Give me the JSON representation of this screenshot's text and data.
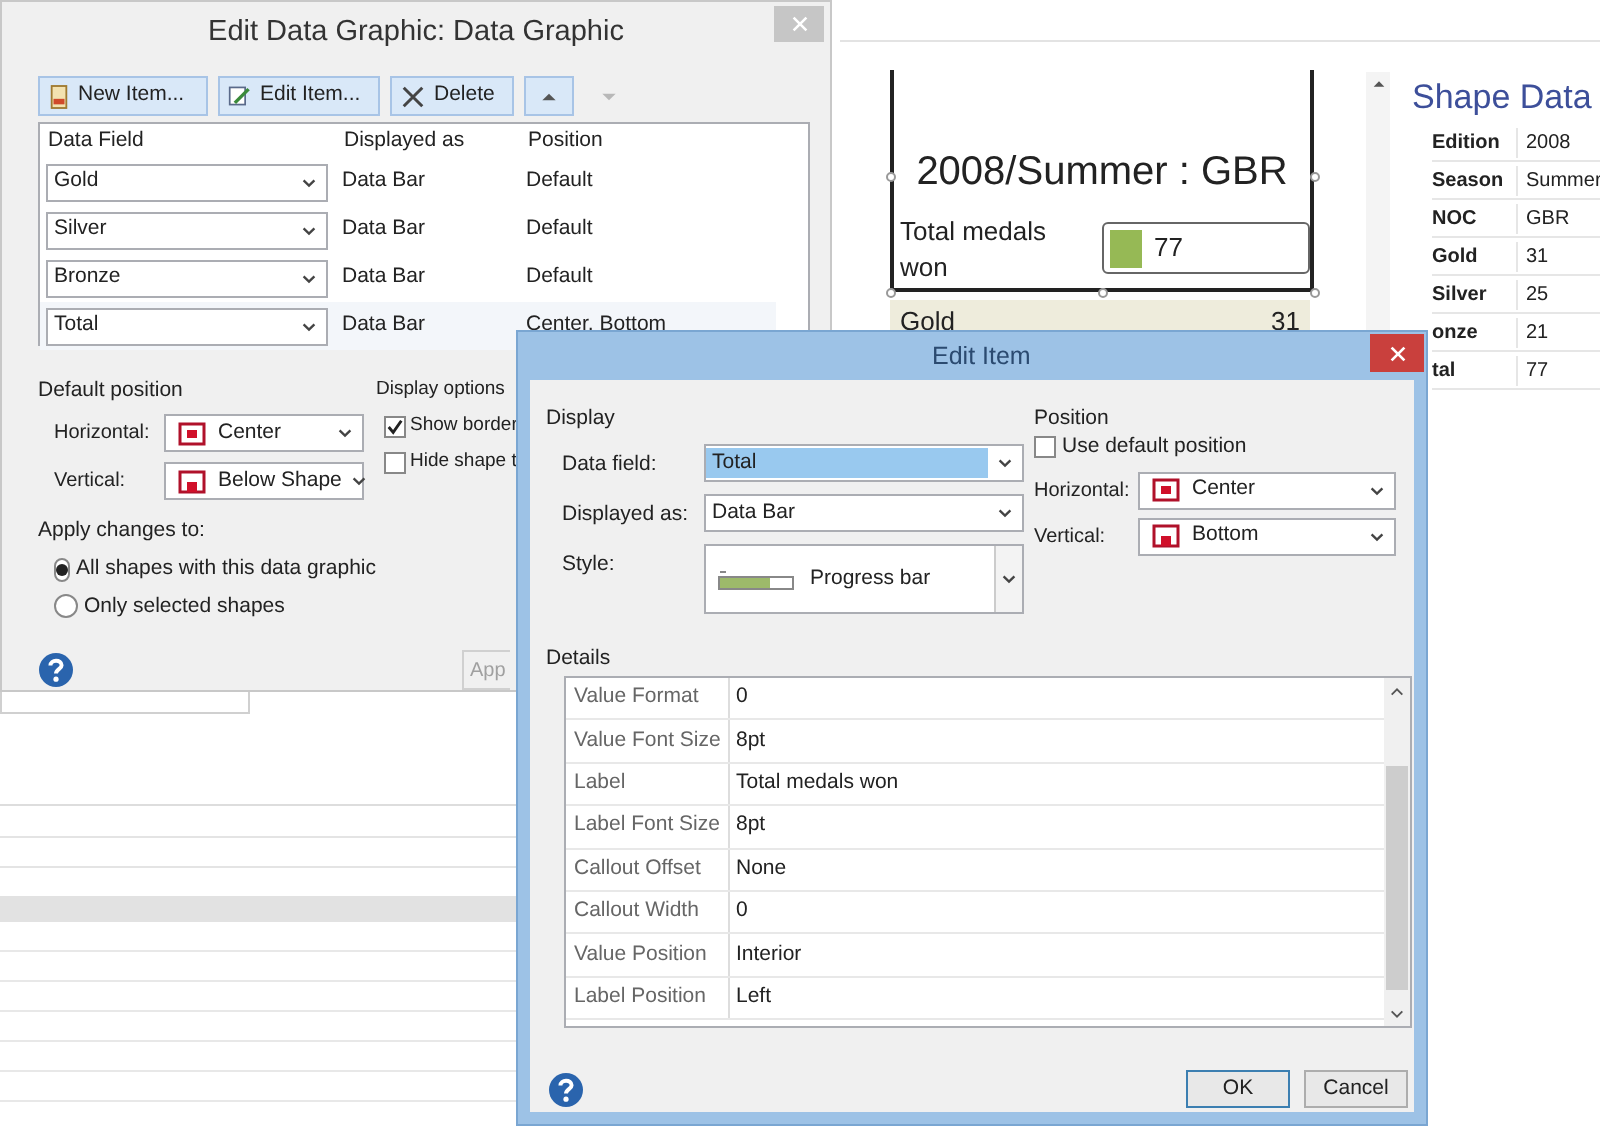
{
  "edit_data_graphic": {
    "title": "Edit Data Graphic: Data Graphic",
    "toolbar": [
      {
        "kind": "new",
        "label": "New Item..."
      },
      {
        "kind": "edit",
        "label": "Edit Item..."
      },
      {
        "kind": "delete",
        "label": "Delete"
      },
      {
        "kind": "move-up",
        "disabled": false
      },
      {
        "kind": "move-down",
        "disabled": true
      }
    ],
    "columns": [
      "Data Field",
      "Displayed as",
      "Position"
    ],
    "rows": [
      {
        "data_field": "Gold",
        "displayed_as": "Data Bar",
        "position": "Default",
        "selected": false
      },
      {
        "data_field": "Silver",
        "displayed_as": "Data Bar",
        "position": "Default",
        "selected": false
      },
      {
        "data_field": "Bronze",
        "displayed_as": "Data Bar",
        "position": "Default",
        "selected": false
      },
      {
        "data_field": "Total",
        "displayed_as": "Data Bar",
        "position": "Center, Bottom",
        "selected": true
      }
    ],
    "default_position": {
      "heading": "Default position",
      "fields": [
        {
          "label": "Horizontal:",
          "value": "Center"
        },
        {
          "label": "Vertical:",
          "value": "Below Shape"
        }
      ]
    },
    "display_options": {
      "heading": "Display options",
      "options": [
        {
          "label": "Show border",
          "checked": true
        },
        {
          "label": "Hide shape t",
          "checked": false
        }
      ]
    },
    "apply_changes": {
      "heading": "Apply changes to:",
      "options": [
        {
          "label": "All shapes with this data graphic",
          "selected": true
        },
        {
          "label": "Only selected shapes",
          "selected": false
        }
      ]
    },
    "apply_button": "App"
  },
  "canvas": {
    "shape_title": "2008/Summer : GBR",
    "bar_label": "Total medals won",
    "bar_value": "77",
    "legend_row": {
      "label": "Gold",
      "value": "31"
    }
  },
  "shape_data": {
    "title": "Shape Data",
    "rows": [
      {
        "label": "Edition",
        "value": "2008"
      },
      {
        "label": "Season",
        "value": "Summer"
      },
      {
        "label": "NOC",
        "value": "GBR"
      },
      {
        "label": "Gold",
        "value": "31"
      },
      {
        "label": "Silver",
        "value": "25"
      },
      {
        "label": "onze",
        "value": "21"
      },
      {
        "label": "tal",
        "value": "77"
      }
    ]
  },
  "edit_item": {
    "title": "Edit Item",
    "display": {
      "heading": "Display",
      "fields": [
        {
          "kind": "combo",
          "label": "Data field:",
          "value": "Total",
          "highlighted": true
        },
        {
          "kind": "combo",
          "label": "Displayed as:",
          "value": "Data Bar",
          "highlighted": false
        },
        {
          "kind": "style",
          "label": "Style:",
          "value": "Progress bar"
        }
      ]
    },
    "position": {
      "heading": "Position",
      "use_default": {
        "label": "Use default position",
        "checked": false
      },
      "fields": [
        {
          "label": "Horizontal:",
          "value": "Center"
        },
        {
          "label": "Vertical:",
          "value": "Bottom"
        }
      ]
    },
    "details": {
      "heading": "Details",
      "rows": [
        {
          "name": "Value Format",
          "value": "0"
        },
        {
          "name": "Value Font Size",
          "value": "8pt"
        },
        {
          "name": "Label",
          "value": "Total medals won"
        },
        {
          "name": "Label Font Size",
          "value": "8pt"
        },
        {
          "name": "Callout Offset",
          "value": "None"
        },
        {
          "name": "Callout Width",
          "value": "0"
        },
        {
          "name": "Value Position",
          "value": "Interior"
        },
        {
          "name": "Label Position",
          "value": "Left"
        }
      ]
    },
    "buttons": [
      "OK",
      "Cancel"
    ]
  }
}
